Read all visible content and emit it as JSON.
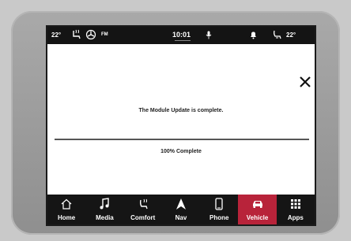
{
  "status_bar": {
    "temp_left": "22°",
    "radio_band": "FM",
    "clock": "10:01",
    "temp_right": "22°"
  },
  "dialog": {
    "message": "The Module Update is complete.",
    "progress_text": "100% Complete"
  },
  "nav": {
    "home": "Home",
    "media": "Media",
    "comfort": "Comfort",
    "nav": "Nav",
    "phone": "Phone",
    "vehicle": "Vehicle",
    "apps": "Apps",
    "active": "Vehicle",
    "active_color": "#b8233a"
  }
}
